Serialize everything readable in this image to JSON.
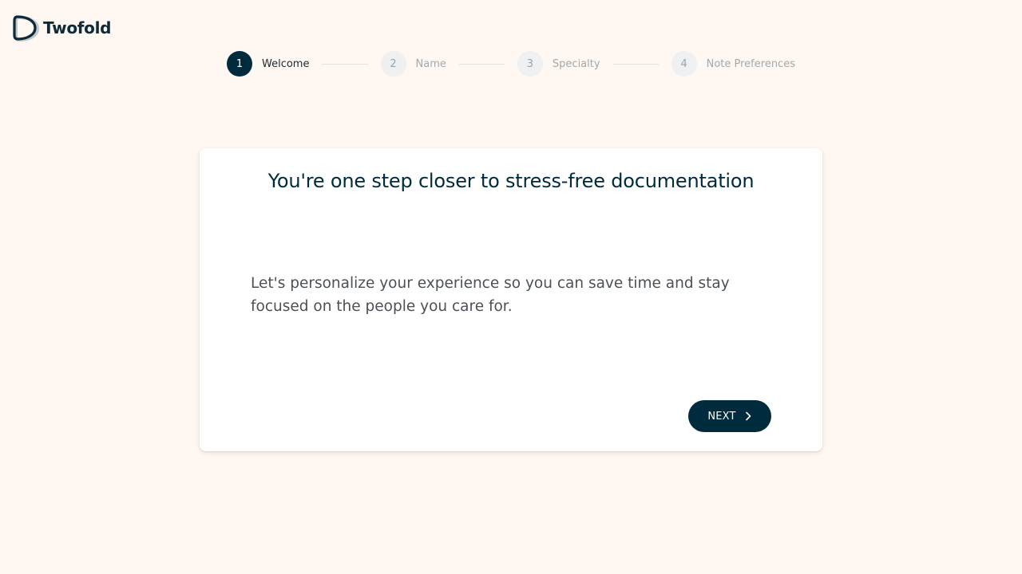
{
  "app": {
    "brand_name": "Twofold",
    "logo_icon": "twofold-logo-icon"
  },
  "stepper": {
    "steps": [
      {
        "number": "1",
        "label": "Welcome",
        "state": "active"
      },
      {
        "number": "2",
        "label": "Name",
        "state": "inactive"
      },
      {
        "number": "3",
        "label": "Specialty",
        "state": "inactive"
      },
      {
        "number": "4",
        "label": "Note Preferences",
        "state": "inactive"
      }
    ]
  },
  "card": {
    "title": "You're one step closer to stress-free documentation",
    "body": "Let's personalize your experience so you can save time and stay focused on the people you care for.",
    "next_label": "NEXT",
    "next_icon": "chevron-right-icon"
  },
  "colors": {
    "background": "#fff7f1",
    "primary": "#002b3d",
    "card": "#ffffff",
    "step_inactive_bg": "#eef0f2",
    "step_inactive_text": "#a3a9ae",
    "body_text": "#4b5157"
  }
}
